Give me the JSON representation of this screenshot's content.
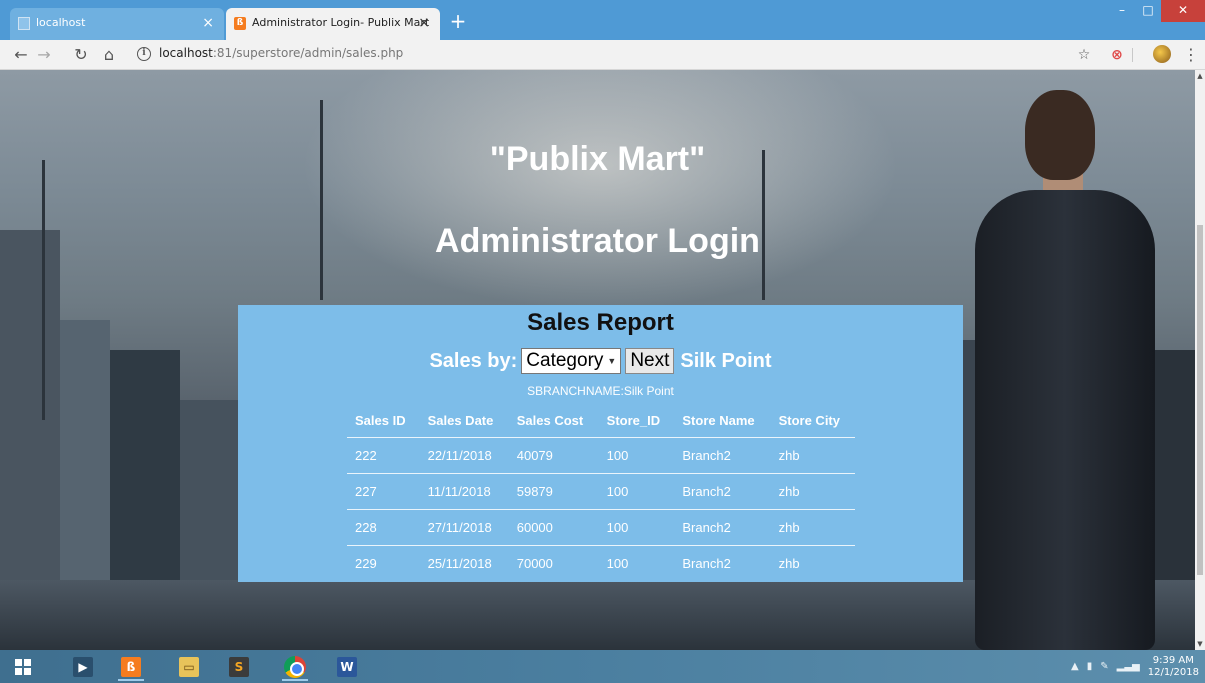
{
  "browser": {
    "tabs": [
      {
        "title": "localhost",
        "active": false
      },
      {
        "title": "Administrator Login- Publix Mart",
        "active": true
      }
    ],
    "new_tab_glyph": "+",
    "window_controls": {
      "minimize": "–",
      "maximize": "□",
      "close": "✕"
    },
    "address": {
      "host": "localhost",
      "path": ":81/superstore/admin/sales.php"
    },
    "icons": [
      "back-icon",
      "forward-icon",
      "reload-icon",
      "home-icon",
      "info-icon",
      "star-icon",
      "extension-icon",
      "profile-icon",
      "menu-icon"
    ]
  },
  "page": {
    "brand_title": "\"Publix Mart\"",
    "admin_title": "Administrator Login",
    "report": {
      "title": "Sales Report",
      "sales_by_label": "Sales by:",
      "select_value": "Category",
      "next_label": "Next",
      "branch_name": "Silk Point",
      "branch_line": "SBRANCHNAME:Silk Point",
      "columns": [
        "Sales ID",
        "Sales Date",
        "Sales Cost",
        "Store_ID",
        "Store Name",
        "Store City"
      ],
      "rows": [
        [
          "222",
          "22/11/2018",
          "40079",
          "100",
          "Branch2",
          "zhb"
        ],
        [
          "227",
          "11/11/2018",
          "59879",
          "100",
          "Branch2",
          "zhb"
        ],
        [
          "228",
          "27/11/2018",
          "60000",
          "100",
          "Branch2",
          "zhb"
        ],
        [
          "229",
          "25/11/2018",
          "70000",
          "100",
          "Branch2",
          "zhb"
        ]
      ]
    }
  },
  "taskbar": {
    "apps": [
      "start",
      "visual-studio",
      "xampp",
      "file-explorer",
      "sublime-text",
      "chrome",
      "word"
    ],
    "clock_time": "9:39 AM",
    "clock_date": "12/1/2018"
  },
  "colors": {
    "tab_bar": "#4f9ad5",
    "panel": "#7dbde9",
    "close_button": "#c7413b"
  }
}
